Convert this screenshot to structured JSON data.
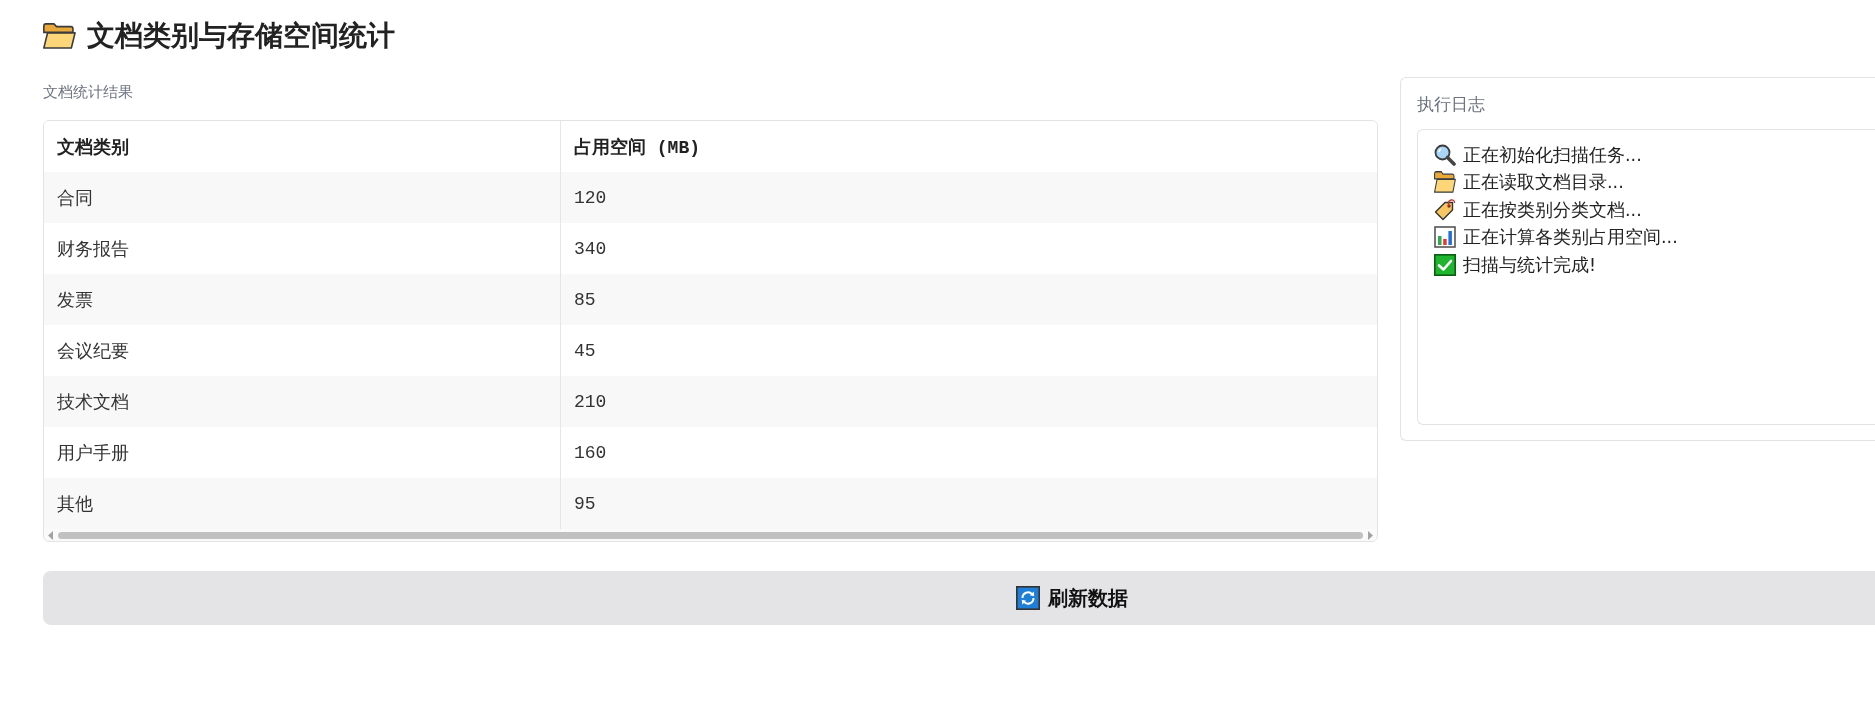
{
  "title": "文档类别与存储空间统计",
  "results": {
    "label": "文档统计结果",
    "table": {
      "columns": [
        "文档类别",
        "占用空间 (MB)"
      ],
      "rows": [
        [
          "合同",
          "120"
        ],
        [
          "财务报告",
          "340"
        ],
        [
          "发票",
          "85"
        ],
        [
          "会议纪要",
          "45"
        ],
        [
          "技术文档",
          "210"
        ],
        [
          "用户手册",
          "160"
        ],
        [
          "其他",
          "95"
        ]
      ]
    }
  },
  "log": {
    "title": "执行日志",
    "entries": [
      {
        "kind": "search",
        "text": "正在初始化扫描任务..."
      },
      {
        "kind": "folder",
        "text": "正在读取文档目录..."
      },
      {
        "kind": "tag",
        "text": "正在按类别分类文档..."
      },
      {
        "kind": "chart",
        "text": "正在计算各类别占用空间..."
      },
      {
        "kind": "done",
        "text": "扫描与统计完成!"
      }
    ]
  },
  "refresh_button": {
    "label": "刷新数据"
  }
}
